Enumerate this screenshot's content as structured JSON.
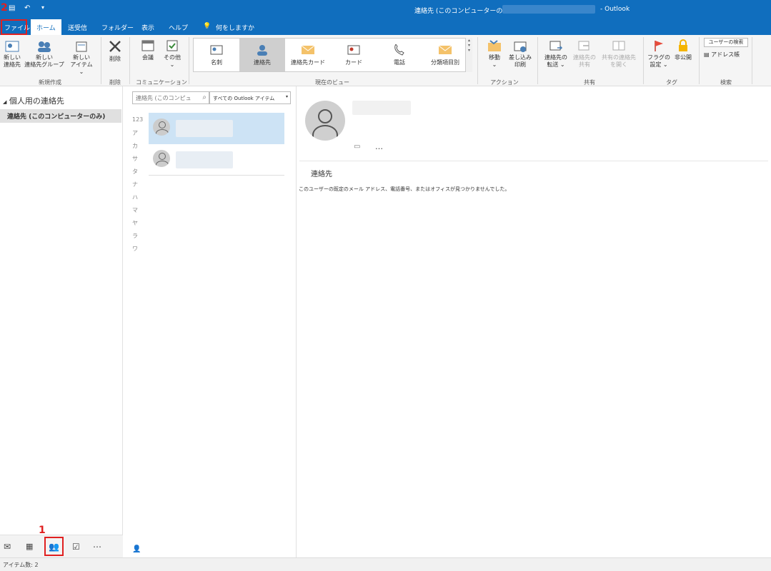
{
  "titlebar": {
    "window_title": "連絡先 (このコンピューターのみ)",
    "app_name": "- Outlook",
    "undo_icon": "↶",
    "qa_icon": "▾"
  },
  "annotations": {
    "one": "1",
    "two": "2"
  },
  "tabs": [
    {
      "label": "ファイル"
    },
    {
      "label": "ホーム"
    },
    {
      "label": "送受信"
    },
    {
      "label": "フォルダー"
    },
    {
      "label": "表示"
    },
    {
      "label": "ヘルプ"
    },
    {
      "label": "何をしますか"
    }
  ],
  "ribbon": {
    "new_contact": "新しい\n連絡先",
    "new_group": "新しい\n連絡先グループ",
    "new_items": "新しい\nアイテム ⌄",
    "delete": "削除",
    "meeting": "会議",
    "more": "その他\n⌄",
    "group_new": "新規作成",
    "group_delete": "削除",
    "group_comm": "コミュニケーション",
    "group_view": "現在のビュー",
    "group_actions": "アクション",
    "group_share": "共有",
    "group_tags": "タグ",
    "group_find": "検索",
    "views": [
      "名刺",
      "連絡先",
      "連絡先カード",
      "カード",
      "電話",
      "分類項目別"
    ],
    "move": "移動\n⌄",
    "mail_merge": "差し込み\n印刷",
    "forward": "連絡先の\n転送 ⌄",
    "share_contacts": "連絡先の\n共有",
    "open_shared": "共有の連絡先\nを開く",
    "flag": "フラグの\n設定 ⌄",
    "private": "非公開",
    "search_people": "ユーザーの検索",
    "address_book": "アドレス帳"
  },
  "nav": {
    "section": "個人用の連絡先",
    "folder": "連絡先 (このコンピューターのみ)"
  },
  "list": {
    "search_placeholder": "連絡先 (このコンピュ",
    "scope": "すべての Outlook アイテム",
    "index": [
      "123",
      "ア",
      "カ",
      "サ",
      "タ",
      "ナ",
      "ハ",
      "マ",
      "ヤ",
      "ラ",
      "ワ"
    ]
  },
  "reading": {
    "section_label": "連絡先",
    "message": "このユーザーの既定のメール アドレス、電話番号、またはオフィスが見つかりませんでした。",
    "ellipsis": "…"
  },
  "status": {
    "count": "アイテム数: 2"
  }
}
